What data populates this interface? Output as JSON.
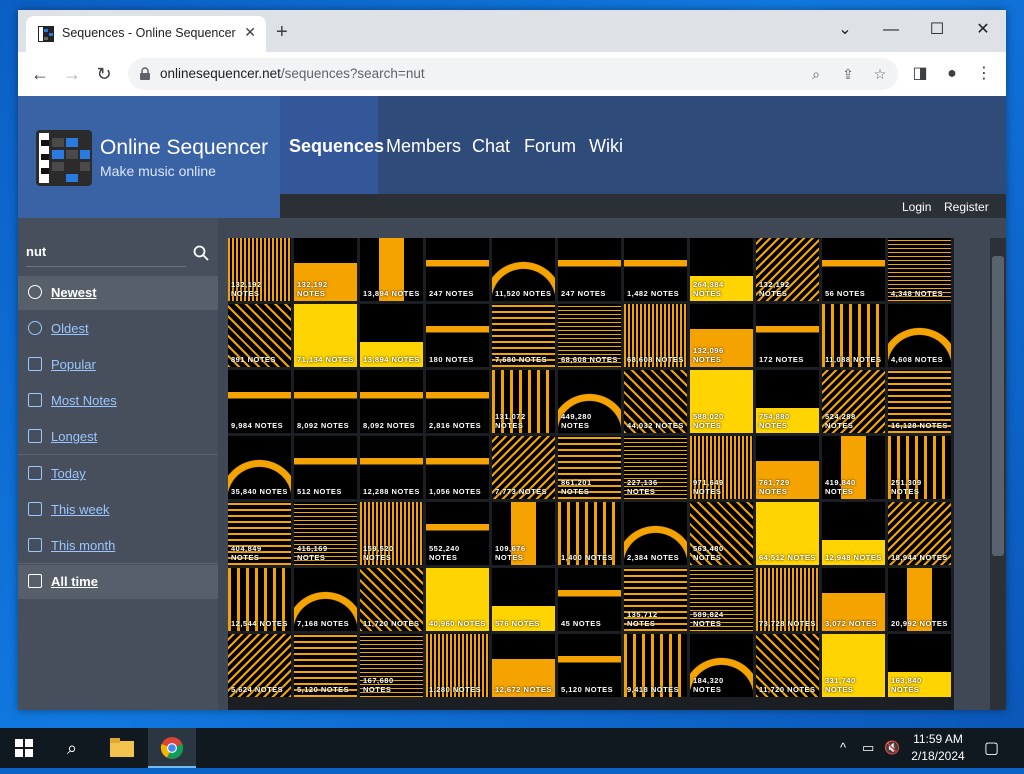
{
  "browser": {
    "tab_title": "Sequences - Online Sequencer",
    "url_host": "onlinesequencer.net",
    "url_path": "/sequences?search=nut",
    "new_tab": "+",
    "close": "✕"
  },
  "site": {
    "name": "Online Sequencer",
    "tagline": "Make music online",
    "nav": [
      "Sequences",
      "Members",
      "Chat",
      "Forum",
      "Wiki"
    ],
    "login": "Login",
    "register": "Register"
  },
  "sidebar": {
    "search_value": "nut",
    "items": [
      {
        "label": "Newest",
        "icon": "clock-icon"
      },
      {
        "label": "Oldest",
        "icon": "history-icon"
      },
      {
        "label": "Popular",
        "icon": "chart-icon"
      },
      {
        "label": "Most Notes",
        "icon": "pencil-icon"
      },
      {
        "label": "Longest",
        "icon": "hourglass-icon"
      },
      {
        "label": "Today",
        "icon": "calendar-icon"
      },
      {
        "label": "This week",
        "icon": "calendar-icon"
      },
      {
        "label": "This month",
        "icon": "calendar-icon"
      },
      {
        "label": "All time",
        "icon": "trophy-icon"
      }
    ]
  },
  "grid": {
    "rows": [
      [
        "132,192 NOTES",
        "132,192 NOTES",
        "13,894 NOTES",
        "247 NOTES",
        "11,520 NOTES",
        "247 NOTES",
        "1,482 NOTES",
        "264,384 NOTES",
        "132,192 NOTES",
        "56 NOTES",
        "4,348 NOTES"
      ],
      [
        "891 NOTES",
        "71,134 NOTES",
        "13,894 NOTES",
        "180 NOTES",
        "7,680 NOTES",
        "68,608 NOTES",
        "68,608 NOTES",
        "132,096 NOTES",
        "172 NOTES",
        "11,088 NOTES",
        "4,608 NOTES"
      ],
      [
        "9,984 NOTES",
        "8,092 NOTES",
        "8,092 NOTES",
        "2,816 NOTES",
        "131,072 NOTES",
        "449,280 NOTES",
        "44,032 NOTES",
        "588,020 NOTES",
        "754,880 NOTES",
        "524,288 NOTES",
        "16,128 NOTES"
      ],
      [
        "35,840 NOTES",
        "512 NOTES",
        "12,288 NOTES",
        "1,056 NOTES",
        "7,773 NOTES",
        "861,201 NOTES",
        "227,136 NOTES",
        "971,649 NOTES",
        "761,729 NOTES",
        "419,840 NOTES",
        "251,309 NOTES"
      ],
      [
        "404,849 NOTES",
        "416,169 NOTES",
        "159,520 NOTES",
        "552,240 NOTES",
        "109,676 NOTES",
        "1,400 NOTES",
        "2,384 NOTES",
        "563,480 NOTES",
        "64,512 NOTES",
        "12,948 NOTES",
        "18,944 NOTES"
      ],
      [
        "12,544 NOTES",
        "7,168 NOTES",
        "11,720 NOTES",
        "40,960 NOTES",
        "576 NOTES",
        "45 NOTES",
        "135,712 NOTES",
        "589,824 NOTES",
        "73,728 NOTES",
        "3,072 NOTES",
        "20,992 NOTES"
      ],
      [
        "5,624 NOTES",
        "5,120 NOTES",
        "167,680 NOTES",
        "1,280 NOTES",
        "12,672 NOTES",
        "5,120 NOTES",
        "9,418 NOTES",
        "184,320 NOTES",
        "11,720 NOTES",
        "331,740 NOTES",
        "163,840 NOTES"
      ]
    ]
  },
  "taskbar": {
    "time": "11:59 AM",
    "date": "2/18/2024"
  },
  "colors": {
    "accent": "#f5a300",
    "bright": "#ffd400",
    "header": "#2e4b7a",
    "brand": "#3a63a6"
  }
}
